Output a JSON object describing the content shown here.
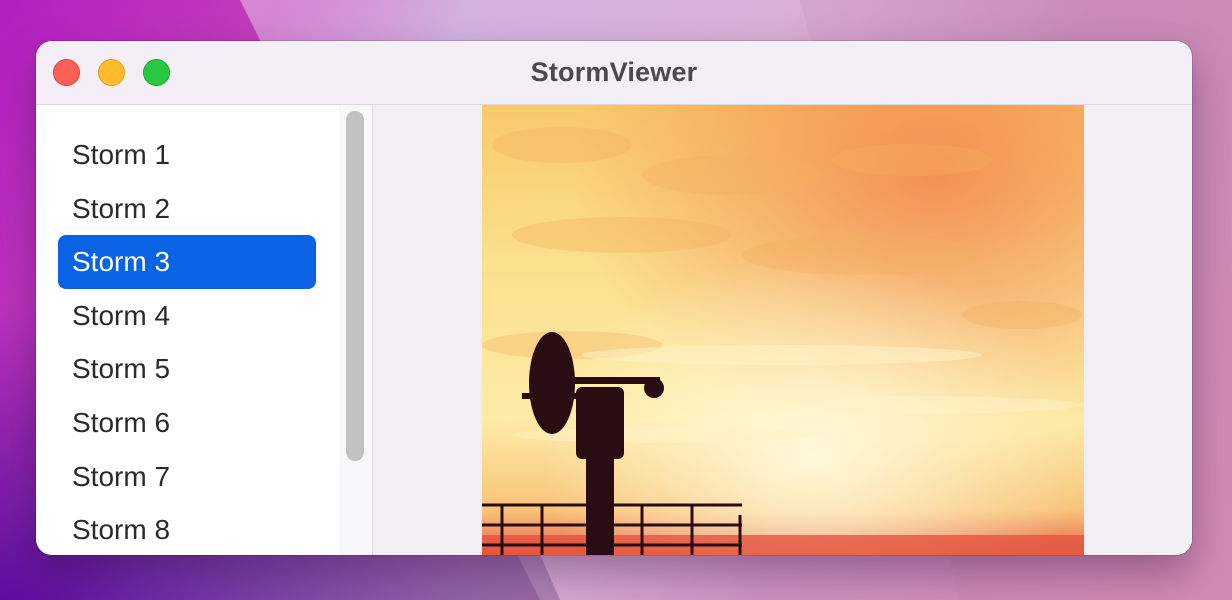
{
  "window": {
    "title": "StormViewer"
  },
  "sidebar": {
    "items": [
      {
        "label": "Storm 1",
        "selected": false
      },
      {
        "label": "Storm 2",
        "selected": false
      },
      {
        "label": "Storm 3",
        "selected": true
      },
      {
        "label": "Storm 4",
        "selected": false
      },
      {
        "label": "Storm 5",
        "selected": false
      },
      {
        "label": "Storm 6",
        "selected": false
      },
      {
        "label": "Storm 7",
        "selected": false
      },
      {
        "label": "Storm 8",
        "selected": false
      }
    ]
  },
  "colors": {
    "selection": "#0963e4",
    "close": "#fe5f57",
    "minimize": "#febc2e",
    "zoom": "#28c840"
  },
  "icons": [
    "close-window-icon",
    "minimize-window-icon",
    "zoom-window-icon"
  ]
}
